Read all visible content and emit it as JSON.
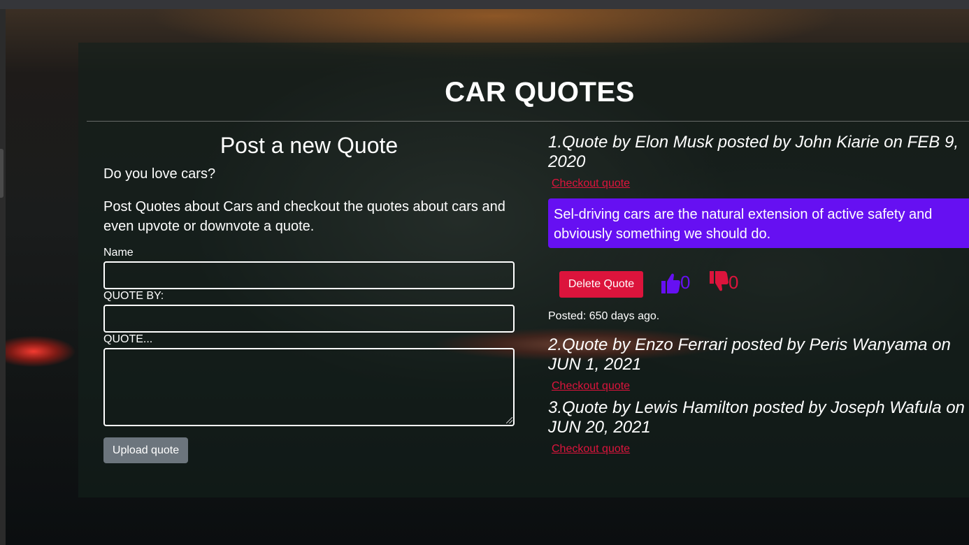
{
  "page": {
    "title": "CAR QUOTES"
  },
  "form": {
    "heading": "Post a new Quote",
    "intro_question": "Do you love cars?",
    "intro_text": "Post Quotes about Cars and checkout the quotes about cars and even upvote or downvote a quote.",
    "name_label": "Name",
    "name_value": "",
    "quote_by_label": "QUOTE BY:",
    "quote_by_value": "",
    "quote_label": "QUOTE...",
    "quote_value": "",
    "submit_label": "Upload quote"
  },
  "quotes": [
    {
      "heading": "1.Quote by Elon Musk posted by John Kiarie on FEB 9, 2020",
      "link_label": "Checkout quote",
      "text": "Sel-driving cars are the natural extension of active safety and obviously something we should do.",
      "delete_label": "Delete Quote",
      "upvotes": "0",
      "downvotes": "0",
      "posted": "Posted: 650 days ago."
    },
    {
      "heading": "2.Quote by Enzo Ferrari posted by Peris Wanyama on JUN 1, 2021",
      "link_label": "Checkout quote"
    },
    {
      "heading": "3.Quote by Lewis Hamilton posted by Joseph Wafula on JUN 20, 2021",
      "link_label": "Checkout quote"
    }
  ],
  "colors": {
    "upvote": "#6610f2",
    "downvote": "#dc143c",
    "link": "#dc143c",
    "quote_box": "#6610f2",
    "submit_button": "#6c757d"
  },
  "icons": {
    "upvote": "thumbs-up-icon",
    "downvote": "thumbs-down-icon"
  }
}
